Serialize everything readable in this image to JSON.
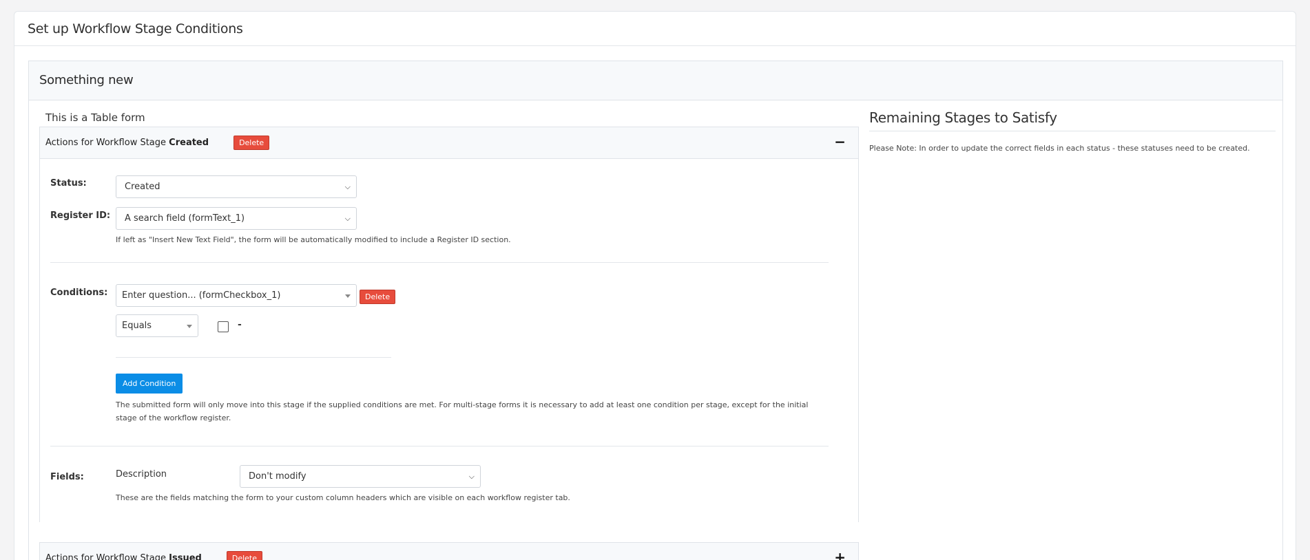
{
  "page": {
    "title": "Set up Workflow Stage Conditions"
  },
  "workflow": {
    "name": "Something new",
    "form_type_text": "This is a Table form"
  },
  "stages": [
    {
      "prefix": "Actions for Workflow Stage",
      "name": "Created",
      "delete_label": "Delete",
      "toggle_icon": "−",
      "expanded": true,
      "status": {
        "label": "Status:",
        "value": "Created"
      },
      "register_id": {
        "label": "Register ID:",
        "value": "A search field (formText_1)",
        "help": "If left as \"Insert New Text Field\", the form will be automatically modified to include a Register ID section."
      },
      "conditions": {
        "label": "Conditions:",
        "question_value": "Enter question... (formCheckbox_1)",
        "delete_label": "Delete",
        "operator_value": "Equals",
        "checkbox_checked": false,
        "dash": "-",
        "add_label": "Add Condition",
        "help": "The submitted form will only move into this stage if the supplied conditions are met. For multi-stage forms it is necessary to add at least one condition per stage, except for the initial stage of the workflow register."
      },
      "fields": {
        "label": "Fields:",
        "field_name": "Description",
        "field_value": "Don't modify",
        "help": "These are the fields matching the form to your custom column headers which are visible on each workflow register tab."
      }
    },
    {
      "prefix": "Actions for Workflow Stage",
      "name": "Issued",
      "delete_label": "Delete",
      "toggle_icon": "+",
      "expanded": false
    }
  ],
  "remaining": {
    "title": "Remaining Stages to Satisfy",
    "note": "Please Note: In order to update the correct fields in each status - these statuses need to be created."
  },
  "colors": {
    "danger": "#e74c3c",
    "primary": "#0b8de6"
  }
}
